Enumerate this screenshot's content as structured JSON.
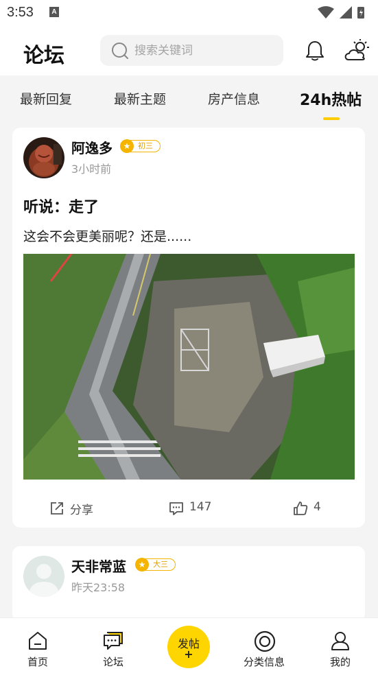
{
  "status_bar": {
    "time": "3:53",
    "notification_letter": "A"
  },
  "header": {
    "title": "论坛",
    "search": {
      "placeholder": "搜索关键词",
      "value": ""
    },
    "icons": [
      "bell-icon",
      "weather-icon"
    ]
  },
  "tabs": {
    "items": [
      {
        "label": "最新回复"
      },
      {
        "label": "最新主题"
      },
      {
        "label": "房产信息"
      },
      {
        "label": "24h热帖"
      }
    ],
    "active_index": 3
  },
  "posts": [
    {
      "author": "阿逸多",
      "level": "初三",
      "time": "3小时前",
      "title": "听说：走了",
      "excerpt": "这会不会更美丽呢？还是......",
      "actions": {
        "share_label": "分享",
        "comments": "147",
        "likes": "4"
      }
    },
    {
      "author": "天非常蓝",
      "level": "大三",
      "time": "昨天23:58"
    }
  ],
  "bottom_nav": {
    "items": [
      {
        "label": "首页",
        "icon": "home-icon"
      },
      {
        "label": "论坛",
        "icon": "forum-icon"
      },
      {
        "label": "分类信息",
        "icon": "category-icon"
      },
      {
        "label": "我的",
        "icon": "user-icon"
      }
    ],
    "post_button": {
      "label": "发帖",
      "plus": "+"
    }
  },
  "colors": {
    "accent": "#ffd500",
    "badge": "#f4b400",
    "background": "#f4f4f4"
  }
}
